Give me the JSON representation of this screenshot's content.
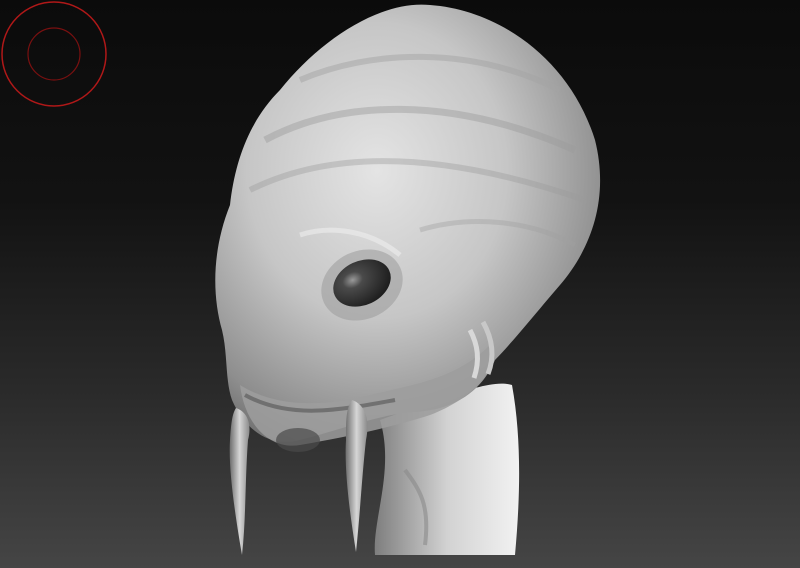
{
  "app": {
    "name": "",
    "canvas_background": "#0b0b0b",
    "canvas_background_bottom": "#454545"
  },
  "model": {
    "subject": "alien-creature-head",
    "material_color": "#bdbdbd",
    "eye_color": "#2a2a2a"
  },
  "brush": {
    "icon": "brush-radius-circle-icon",
    "outer_color": "#b01818",
    "inner_color": "#7a1010"
  }
}
